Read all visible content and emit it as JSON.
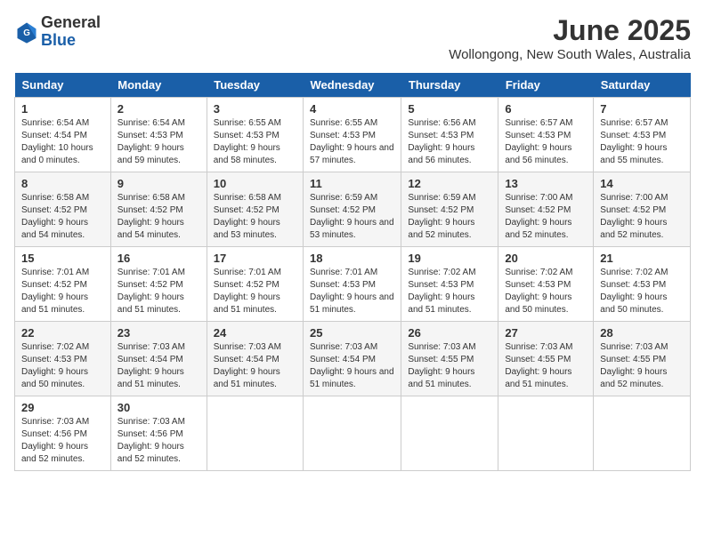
{
  "header": {
    "logo_general": "General",
    "logo_blue": "Blue",
    "month_year": "June 2025",
    "location": "Wollongong, New South Wales, Australia"
  },
  "weekdays": [
    "Sunday",
    "Monday",
    "Tuesday",
    "Wednesday",
    "Thursday",
    "Friday",
    "Saturday"
  ],
  "weeks": [
    [
      {
        "day": "1",
        "sunrise": "6:54 AM",
        "sunset": "4:54 PM",
        "daylight": "10 hours and 0 minutes."
      },
      {
        "day": "2",
        "sunrise": "6:54 AM",
        "sunset": "4:53 PM",
        "daylight": "9 hours and 59 minutes."
      },
      {
        "day": "3",
        "sunrise": "6:55 AM",
        "sunset": "4:53 PM",
        "daylight": "9 hours and 58 minutes."
      },
      {
        "day": "4",
        "sunrise": "6:55 AM",
        "sunset": "4:53 PM",
        "daylight": "9 hours and 57 minutes."
      },
      {
        "day": "5",
        "sunrise": "6:56 AM",
        "sunset": "4:53 PM",
        "daylight": "9 hours and 56 minutes."
      },
      {
        "day": "6",
        "sunrise": "6:57 AM",
        "sunset": "4:53 PM",
        "daylight": "9 hours and 56 minutes."
      },
      {
        "day": "7",
        "sunrise": "6:57 AM",
        "sunset": "4:53 PM",
        "daylight": "9 hours and 55 minutes."
      }
    ],
    [
      {
        "day": "8",
        "sunrise": "6:58 AM",
        "sunset": "4:52 PM",
        "daylight": "9 hours and 54 minutes."
      },
      {
        "day": "9",
        "sunrise": "6:58 AM",
        "sunset": "4:52 PM",
        "daylight": "9 hours and 54 minutes."
      },
      {
        "day": "10",
        "sunrise": "6:58 AM",
        "sunset": "4:52 PM",
        "daylight": "9 hours and 53 minutes."
      },
      {
        "day": "11",
        "sunrise": "6:59 AM",
        "sunset": "4:52 PM",
        "daylight": "9 hours and 53 minutes."
      },
      {
        "day": "12",
        "sunrise": "6:59 AM",
        "sunset": "4:52 PM",
        "daylight": "9 hours and 52 minutes."
      },
      {
        "day": "13",
        "sunrise": "7:00 AM",
        "sunset": "4:52 PM",
        "daylight": "9 hours and 52 minutes."
      },
      {
        "day": "14",
        "sunrise": "7:00 AM",
        "sunset": "4:52 PM",
        "daylight": "9 hours and 52 minutes."
      }
    ],
    [
      {
        "day": "15",
        "sunrise": "7:01 AM",
        "sunset": "4:52 PM",
        "daylight": "9 hours and 51 minutes."
      },
      {
        "day": "16",
        "sunrise": "7:01 AM",
        "sunset": "4:52 PM",
        "daylight": "9 hours and 51 minutes."
      },
      {
        "day": "17",
        "sunrise": "7:01 AM",
        "sunset": "4:52 PM",
        "daylight": "9 hours and 51 minutes."
      },
      {
        "day": "18",
        "sunrise": "7:01 AM",
        "sunset": "4:53 PM",
        "daylight": "9 hours and 51 minutes."
      },
      {
        "day": "19",
        "sunrise": "7:02 AM",
        "sunset": "4:53 PM",
        "daylight": "9 hours and 51 minutes."
      },
      {
        "day": "20",
        "sunrise": "7:02 AM",
        "sunset": "4:53 PM",
        "daylight": "9 hours and 50 minutes."
      },
      {
        "day": "21",
        "sunrise": "7:02 AM",
        "sunset": "4:53 PM",
        "daylight": "9 hours and 50 minutes."
      }
    ],
    [
      {
        "day": "22",
        "sunrise": "7:02 AM",
        "sunset": "4:53 PM",
        "daylight": "9 hours and 50 minutes."
      },
      {
        "day": "23",
        "sunrise": "7:03 AM",
        "sunset": "4:54 PM",
        "daylight": "9 hours and 51 minutes."
      },
      {
        "day": "24",
        "sunrise": "7:03 AM",
        "sunset": "4:54 PM",
        "daylight": "9 hours and 51 minutes."
      },
      {
        "day": "25",
        "sunrise": "7:03 AM",
        "sunset": "4:54 PM",
        "daylight": "9 hours and 51 minutes."
      },
      {
        "day": "26",
        "sunrise": "7:03 AM",
        "sunset": "4:55 PM",
        "daylight": "9 hours and 51 minutes."
      },
      {
        "day": "27",
        "sunrise": "7:03 AM",
        "sunset": "4:55 PM",
        "daylight": "9 hours and 51 minutes."
      },
      {
        "day": "28",
        "sunrise": "7:03 AM",
        "sunset": "4:55 PM",
        "daylight": "9 hours and 52 minutes."
      }
    ],
    [
      {
        "day": "29",
        "sunrise": "7:03 AM",
        "sunset": "4:56 PM",
        "daylight": "9 hours and 52 minutes."
      },
      {
        "day": "30",
        "sunrise": "7:03 AM",
        "sunset": "4:56 PM",
        "daylight": "9 hours and 52 minutes."
      },
      null,
      null,
      null,
      null,
      null
    ]
  ]
}
